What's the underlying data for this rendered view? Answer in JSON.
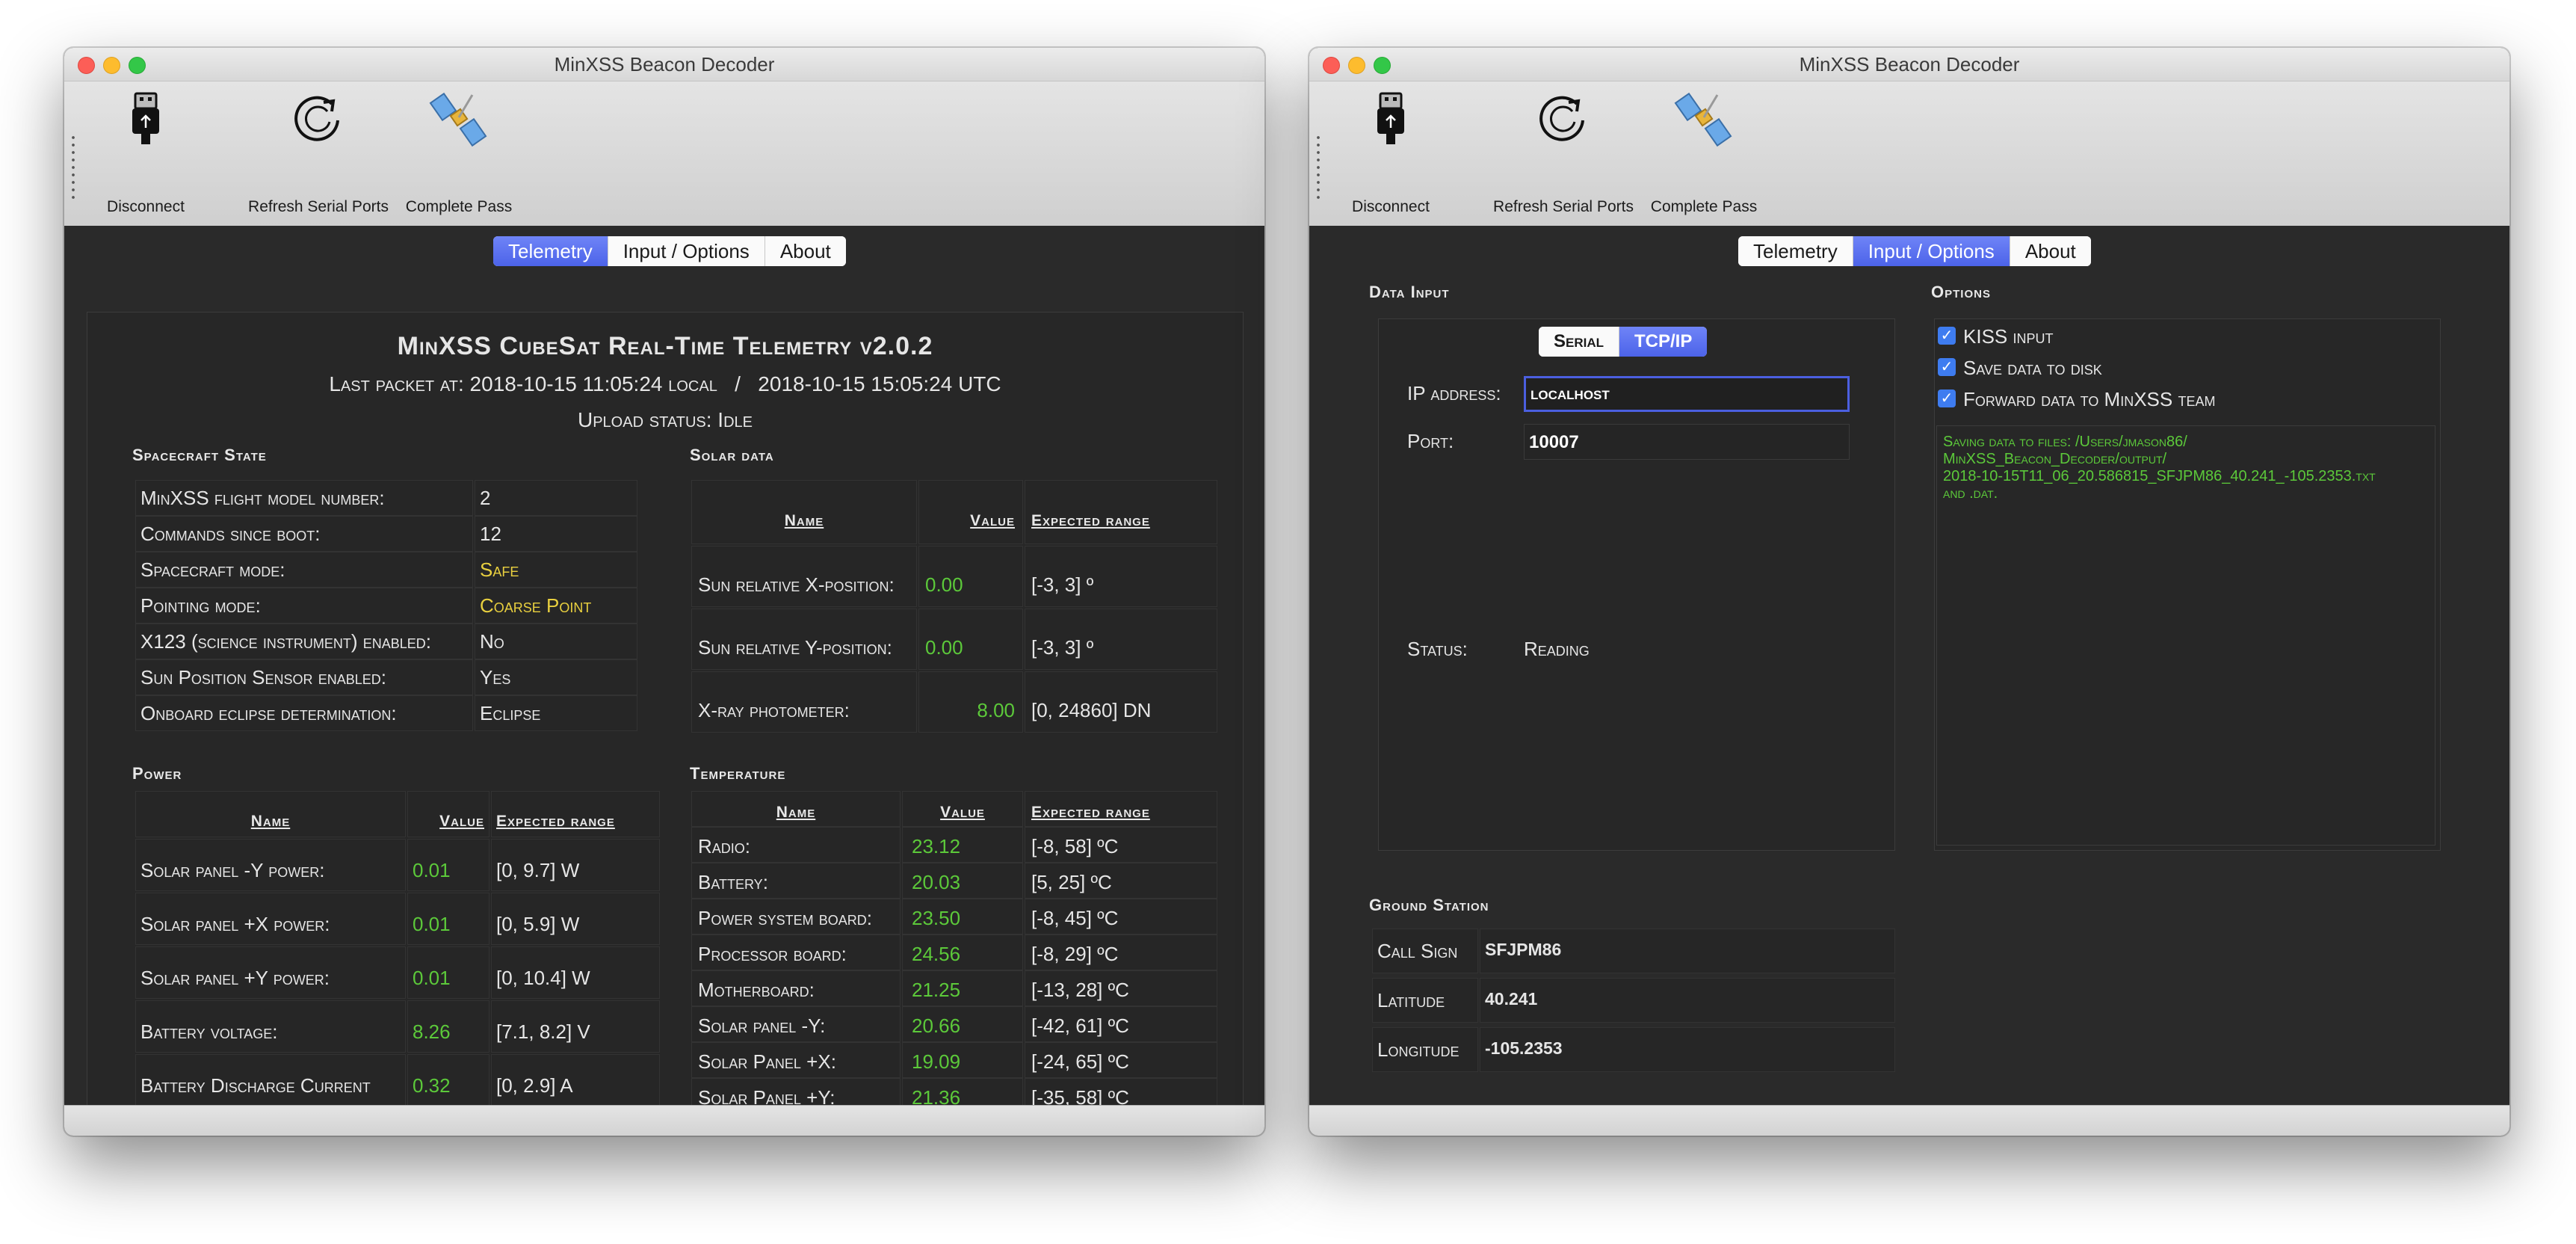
{
  "window_title": "MinXSS Beacon Decoder",
  "toolbar": {
    "disconnect": "Disconnect",
    "refresh": "Refresh Serial Ports",
    "complete_pass": "Complete Pass"
  },
  "tabs": [
    "Telemetry",
    "Input / Options",
    "About"
  ],
  "left": {
    "active_tab": "Telemetry",
    "title": "MinXSS CubeSat Real-Time Telemetry v2.0.2",
    "last_packet": "Last packet at: 2018-10-15 11:05:24 local   /   2018-10-15 15:05:24 UTC",
    "upload_status": "Upload status: Idle",
    "spacecraft_state": {
      "header": "Spacecraft State",
      "rows": [
        {
          "label": "MinXSS flight model number:",
          "value": "2",
          "color": "white"
        },
        {
          "label": "Commands since boot:",
          "value": "12",
          "color": "white"
        },
        {
          "label": "Spacecraft mode:",
          "value": "Safe",
          "color": "yellow"
        },
        {
          "label": "Pointing mode:",
          "value": "Coarse Point",
          "color": "yellow"
        },
        {
          "label": "X123 (science instrument) enabled:",
          "value": "No",
          "color": "white"
        },
        {
          "label": "Sun Position Sensor enabled:",
          "value": "Yes",
          "color": "white"
        },
        {
          "label": "Onboard eclipse determination:",
          "value": "Eclipse",
          "color": "white"
        }
      ]
    },
    "solar_data": {
      "header": "Solar data",
      "columns": [
        "Name",
        "Value",
        "Expected range"
      ],
      "rows": [
        {
          "name": "Sun relative X-position:",
          "value": "0.00",
          "range": "[-3, 3] º"
        },
        {
          "name": "Sun relative Y-position:",
          "value": "0.00",
          "range": "[-3, 3] º"
        },
        {
          "name": "X-ray photometer:",
          "value": "8.00",
          "range": "[0, 24860] DN"
        }
      ]
    },
    "power": {
      "header": "Power",
      "columns": [
        "Name",
        "Value",
        "Expected range"
      ],
      "rows": [
        {
          "name": "Solar panel -Y power:",
          "value": "0.01",
          "range": "[0, 9.7] W"
        },
        {
          "name": "Solar panel +X power:",
          "value": "0.01",
          "range": "[0, 5.9] W"
        },
        {
          "name": "Solar panel +Y power:",
          "value": "0.01",
          "range": "[0, 10.4] W"
        },
        {
          "name": "Battery voltage:",
          "value": "8.26",
          "range": "[7.1, 8.2] V"
        },
        {
          "name": "Battery Discharge Current",
          "value": "0.32",
          "range": "[0, 2.9] A"
        }
      ]
    },
    "temperature": {
      "header": "Temperature",
      "columns": [
        "Name",
        "Value",
        "Expected range"
      ],
      "rows": [
        {
          "name": "Radio:",
          "value": "23.12",
          "range": "[-8, 58] ºC"
        },
        {
          "name": "Battery:",
          "value": "20.03",
          "range": "[5, 25] ºC"
        },
        {
          "name": "Power system board:",
          "value": "23.50",
          "range": "[-8, 45] ºC"
        },
        {
          "name": "Processor board:",
          "value": "24.56",
          "range": "[-8, 29] ºC"
        },
        {
          "name": "Motherboard:",
          "value": "21.25",
          "range": "[-13, 28] ºC"
        },
        {
          "name": "Solar panel -Y:",
          "value": "20.66",
          "range": "[-42, 61] ºC"
        },
        {
          "name": "Solar Panel +X:",
          "value": "19.09",
          "range": "[-24, 65] ºC"
        },
        {
          "name": "Solar Panel +Y:",
          "value": "21.36",
          "range": "[-35, 58] ºC"
        }
      ]
    }
  },
  "right": {
    "active_tab": "Input / Options",
    "data_input_header": "Data Input",
    "mode_tabs": [
      "Serial",
      "TCP/IP"
    ],
    "active_mode": "TCP/IP",
    "ip_label": "IP address:",
    "ip_value": "localhost",
    "port_label": "Port:",
    "port_value": "10007",
    "status_label": "Status:",
    "status_value": "Reading",
    "options_header": "Options",
    "options": [
      {
        "label": "KISS input",
        "checked": true
      },
      {
        "label": "Save data to disk",
        "checked": true
      },
      {
        "label": "Forward data to MinXSS team",
        "checked": true
      }
    ],
    "log_lines": [
      "Saving data to files: /Users/jmason86/",
      "MinXSS_Beacon_Decoder/output/",
      "2018-10-15T11_06_20.586815_SFJPM86_40.241_-105.2353.txt",
      "and .dat."
    ],
    "ground_station_header": "Ground Station",
    "ground_station": [
      {
        "label": "Call Sign",
        "value": "SFJPM86"
      },
      {
        "label": "Latitude",
        "value": "40.241"
      },
      {
        "label": "Longitude",
        "value": "-105.2353"
      }
    ]
  },
  "colors": {
    "accent": "#4c63e9",
    "green": "#5cc93a",
    "yellow": "#e9d03f",
    "background": "#2a2a2a"
  }
}
